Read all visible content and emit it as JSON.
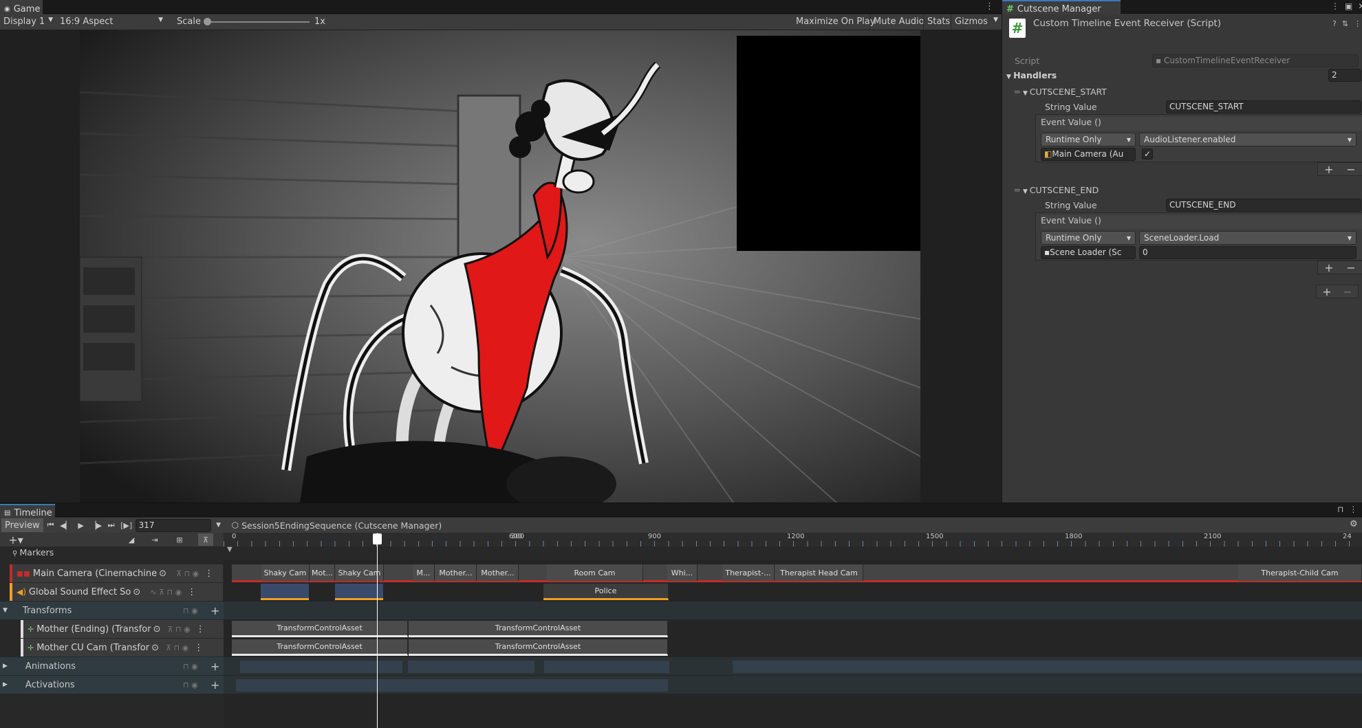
{
  "game": {
    "tab": "Game",
    "display": "Display 1",
    "aspect": "16:9 Aspect",
    "scale_label": "Scale",
    "scale_value": "1x",
    "maximize": "Maximize On Play",
    "mute": "Mute Audio",
    "stats": "Stats",
    "gizmos": "Gizmos"
  },
  "inspector": {
    "tab": "Cutscene Manager",
    "component": "Custom Timeline Event Receiver (Script)",
    "script_label": "Script",
    "script_value": "CustomTimelineEventReceiver",
    "handlers_label": "Handlers",
    "handlers_count": "2",
    "handlers": [
      {
        "name": "CUTSCENE_START",
        "string_label": "String Value",
        "string_value": "CUTSCENE_START",
        "event_label": "Event Value ()",
        "runtime": "Runtime Only",
        "function": "AudioListener.enabled",
        "target": "Main Camera (Au",
        "arg": "✓"
      },
      {
        "name": "CUTSCENE_END",
        "string_label": "String Value",
        "string_value": "CUTSCENE_END",
        "event_label": "Event Value ()",
        "runtime": "Runtime Only",
        "function": "SceneLoader.Load",
        "target": "Scene Loader (Sc",
        "arg": "0"
      }
    ]
  },
  "timeline": {
    "tab": "Timeline",
    "preview": "Preview",
    "frame": "317",
    "sequence": "Session5EndingSequence (Cutscene Manager)",
    "ruler": [
      "0",
      "300",
      "600",
      "900",
      "1200",
      "1500",
      "1800",
      "2100",
      "24"
    ],
    "markers_label": "Markers",
    "tracks": {
      "camera": "Main Camera (Cinemachine",
      "sound": "Global Sound Effect So",
      "transforms": "Transforms",
      "mother_ending": "Mother (Ending) (Transfor",
      "mother_cu": "Mother CU Cam (Transfor",
      "animations": "Animations",
      "activations": "Activations"
    },
    "camera_clips": [
      "Shaky Cam",
      "Mot...",
      "Shaky Cam",
      "M...",
      "Mother...",
      "Mother...",
      "Room Cam",
      "Whi...",
      "Therapist-...",
      "Therapist Head Cam",
      "Therapist-Child Cam"
    ],
    "sound_clip": "Police",
    "transform_clips": [
      "TransformControlAsset",
      "TransformControlAsset"
    ]
  },
  "colors": {
    "accent": "#3a79bb",
    "camera_red": "#c42b2b",
    "sound_orange": "#f0a020",
    "bg": "#282828"
  }
}
